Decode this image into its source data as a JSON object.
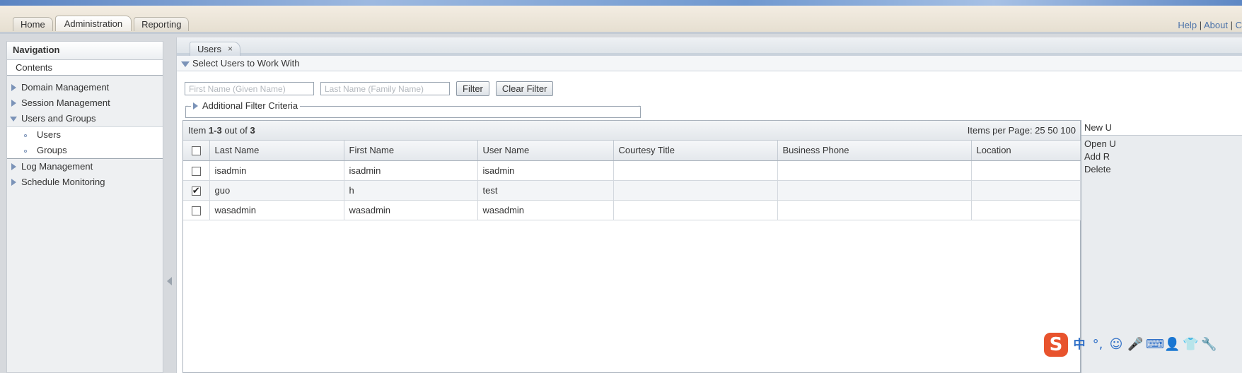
{
  "app": {
    "tabs": [
      "Home",
      "Administration",
      "Reporting"
    ],
    "active_tab": "Administration",
    "links": {
      "help": "Help",
      "about": "About",
      "sep": "|",
      "cut": "C"
    }
  },
  "nav": {
    "title": "Navigation",
    "contents": "Contents",
    "items": [
      "Domain Management",
      "Session Management",
      "Users and Groups",
      "Log Management",
      "Schedule Monitoring"
    ],
    "subitems": [
      "Users",
      "Groups"
    ]
  },
  "content": {
    "tab_label": "Users",
    "tab_close": "×",
    "section_title": "Select Users to Work With",
    "filter": {
      "first_name_placeholder": "First Name (Given Name)",
      "last_name_placeholder": "Last Name (Family Name)",
      "filter_button": "Filter",
      "clear_button": "Clear Filter",
      "additional": "Additional Filter Criteria"
    },
    "grid": {
      "summary_prefix": "Item ",
      "summary_range": "1-3",
      "summary_mid": " out of ",
      "summary_total": "3",
      "items_per_page": "Items per Page: 25 50 100",
      "columns": [
        "Last Name",
        "First Name",
        "User Name",
        "Courtesy Title",
        "Business Phone",
        "Location"
      ],
      "rows": [
        {
          "last": "isadmin",
          "first": "isadmin",
          "user": "isadmin",
          "checked": false
        },
        {
          "last": "guo",
          "first": "h",
          "user": "test",
          "checked": true
        },
        {
          "last": "wasadmin",
          "first": "wasadmin",
          "user": "wasadmin",
          "checked": false
        }
      ]
    },
    "actions": {
      "head": "New U",
      "items": [
        "Open U",
        "Add R",
        "Delete"
      ]
    }
  },
  "ime": {
    "logo": "S",
    "icons": [
      "中",
      "°,",
      "☺",
      "🎤",
      "⌨",
      "👤",
      "👕",
      "🔧"
    ]
  },
  "colors": {
    "accent": "#7b93b8",
    "link": "#4a71a8",
    "ime": "#e8532d"
  }
}
